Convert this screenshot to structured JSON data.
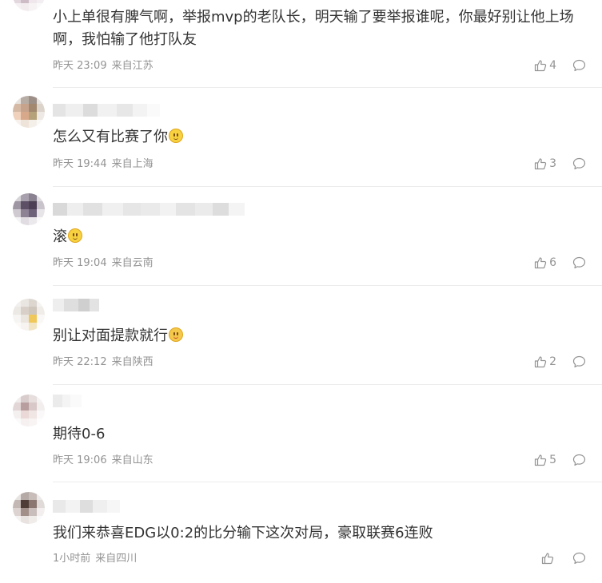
{
  "comments": [
    {
      "text": "小上单很有脾气啊，举报mvp的老队长，明天输了要举报谁呢，你最好别让他上场啊，我怕输了他打队友",
      "emoji": "",
      "time": "昨天 23:09",
      "location": "来自江苏",
      "likes": "4"
    },
    {
      "text": "怎么又有比赛了你",
      "emoji": "smile-emoji",
      "time": "昨天 19:44",
      "location": "来自上海",
      "likes": "3"
    },
    {
      "text": "滚",
      "emoji": "smile-emoji",
      "time": "昨天 19:04",
      "location": "来自云南",
      "likes": "6"
    },
    {
      "text": "别让对面提款就行",
      "emoji": "cute-emoji",
      "time": "昨天 22:12",
      "location": "来自陕西",
      "likes": "2"
    },
    {
      "text": "期待0-6",
      "emoji": "",
      "time": "昨天 19:06",
      "location": "来自山东",
      "likes": "5"
    },
    {
      "text": "我们来恭喜EDG以0:2的比分输下这次对局，豪取联赛6连败",
      "emoji": "",
      "time": "1小时前",
      "location": "来自四川",
      "likes": ""
    }
  ],
  "icons": {
    "like": "thumbs-up-icon",
    "reply": "comment-bubble-icon"
  },
  "colors": {
    "text": "#333333",
    "meta": "#939393",
    "divider": "#ececec"
  }
}
